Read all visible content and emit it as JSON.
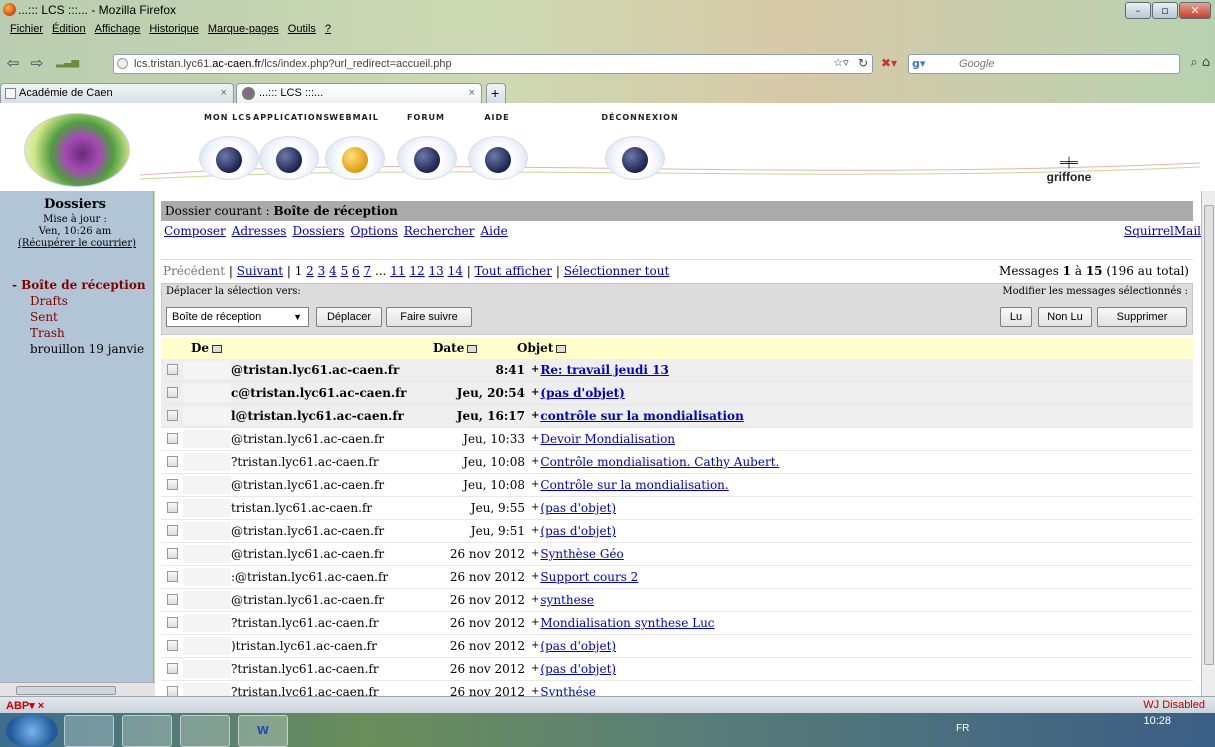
{
  "browser": {
    "window_title": "...::: LCS :::... - Mozilla Firefox",
    "menu": [
      "Fichier",
      "Édition",
      "Affichage",
      "Historique",
      "Marque-pages",
      "Outils",
      "?"
    ],
    "url_prefix": "lcs.tristan.lyc61.",
    "url_host": "ac-caen.fr",
    "url_path": "/lcs/index.php?url_redirect=accueil.php",
    "search_placeholder": "Google",
    "tabs": [
      {
        "label": "Académie de Caen"
      },
      {
        "label": "...::: LCS :::..."
      }
    ],
    "new_tab": "+",
    "status_right": "WJ Disabled"
  },
  "banner": {
    "apps": [
      "MON LCS",
      "APPLICATIONS",
      "WEBMAIL",
      "FORUM",
      "AIDE",
      "DÉCONNEXION"
    ],
    "user": "griffone"
  },
  "sidebar": {
    "title": "Dossiers",
    "updated_label": "Mise à jour :",
    "updated_time": "Ven, 10:26 am",
    "fetch_mail": "(Récupérer le courrier)",
    "folders": [
      "- Boîte de réception",
      "Drafts",
      "Sent",
      "Trash",
      "brouillon 19 janvie"
    ]
  },
  "mail": {
    "current_folder_label": "Dossier courant : ",
    "current_folder": "Boîte de réception",
    "nav_links": [
      "Composer",
      "Adresses",
      "Dossiers",
      "Options",
      "Rechercher",
      "Aide"
    ],
    "squirrelmail": "SquirrelMail",
    "pager": {
      "previous": "Précédent",
      "next": "Suivant",
      "current_page": "1",
      "pages": [
        "2",
        "3",
        "4",
        "5",
        "6",
        "7"
      ],
      "ellipsis": "...",
      "tail_pages": [
        "11",
        "12",
        "13",
        "14"
      ],
      "show_all": "Tout afficher",
      "select_all": "Sélectionner tout"
    },
    "message_count": {
      "prefix": "Messages ",
      "from": "1",
      "to_word": " à ",
      "to": "15",
      "total": " (196 au total)"
    },
    "move_label": "Déplacer la sélection vers:",
    "move_target": "Boîte de réception",
    "move_button": "Déplacer",
    "forward_button": "Faire suivre",
    "modify_label": "Modifier les messages sélectionnés :",
    "read_button": "Lu",
    "unread_button": "Non Lu",
    "delete_button": "Supprimer",
    "columns": {
      "from": "De",
      "date": "Date",
      "subject": "Objet"
    },
    "messages": [
      {
        "from": "@tristan.lyc61.ac-caen.fr",
        "date": "8:41",
        "subject": "Re: travail jeudi 13",
        "unread": true
      },
      {
        "from": "c@tristan.lyc61.ac-caen.fr",
        "date": "Jeu, 20:54",
        "subject": "(pas d'objet)",
        "unread": true
      },
      {
        "from": "l@tristan.lyc61.ac-caen.fr",
        "date": "Jeu, 16:17",
        "subject": "contrôle sur la mondialisation",
        "unread": true
      },
      {
        "from": "@tristan.lyc61.ac-caen.fr",
        "date": "Jeu, 10:33",
        "subject": "Devoir Mondialisation",
        "unread": false
      },
      {
        "from": "?tristan.lyc61.ac-caen.fr",
        "date": "Jeu, 10:08",
        "subject": "Contrôle mondialisation. Cathy Aubert.",
        "unread": false
      },
      {
        "from": "@tristan.lyc61.ac-caen.fr",
        "date": "Jeu, 10:08",
        "subject": "Contrôle sur la mondialisation.",
        "unread": false
      },
      {
        "from": "tristan.lyc61.ac-caen.fr",
        "date": "Jeu, 9:55",
        "subject": "(pas d'objet)",
        "unread": false
      },
      {
        "from": "@tristan.lyc61.ac-caen.fr",
        "date": "Jeu, 9:51",
        "subject": "(pas d'objet)",
        "unread": false
      },
      {
        "from": "@tristan.lyc61.ac-caen.fr",
        "date": "26 nov 2012",
        "subject": "Synthèse Géo",
        "unread": false
      },
      {
        "from": ":@tristan.lyc61.ac-caen.fr",
        "date": "26 nov 2012",
        "subject": "Support cours 2",
        "unread": false
      },
      {
        "from": "@tristan.lyc61.ac-caen.fr",
        "date": "26 nov 2012",
        "subject": "synthese",
        "unread": false
      },
      {
        "from": "?tristan.lyc61.ac-caen.fr",
        "date": "26 nov 2012",
        "subject": "Mondialisation synthese Luc",
        "unread": false
      },
      {
        "from": ")tristan.lyc61.ac-caen.fr",
        "date": "26 nov 2012",
        "subject": "(pas d'objet)",
        "unread": false
      },
      {
        "from": "?tristan.lyc61.ac-caen.fr",
        "date": "26 nov 2012",
        "subject": "(pas d'objet)",
        "unread": false
      },
      {
        "from": "?tristan.lyc61.ac-caen.fr",
        "date": "26 nov 2012",
        "subject": "Synthése",
        "unread": false
      }
    ]
  },
  "taskbar": {
    "lang": "FR",
    "time": "10:28"
  }
}
